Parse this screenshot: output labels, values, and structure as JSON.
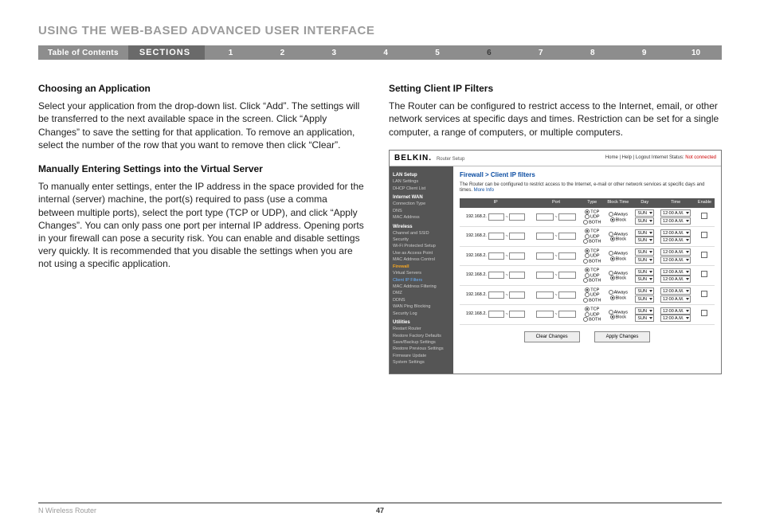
{
  "title": "USING THE WEB-BASED ADVANCED USER INTERFACE",
  "nav": {
    "toc": "Table of Contents",
    "sections": "SECTIONS",
    "items": [
      "1",
      "2",
      "3",
      "4",
      "5",
      "6",
      "7",
      "8",
      "9",
      "10"
    ],
    "active_index": 5
  },
  "left": {
    "h1": "Choosing an Application",
    "p1": "Select your application from the drop-down list. Click “Add”. The settings will be transferred to the next available space in the screen. Click “Apply Changes” to save the setting for that application. To remove an application, select the number of the row that you want to remove then click “Clear”.",
    "h2": "Manually Entering Settings into the Virtual Server",
    "p2": "To manually enter settings, enter the IP address in the space provided for the internal (server) machine, the port(s) required to pass (use a comma between multiple ports), select the port type (TCP or UDP), and click “Apply Changes”. You can only pass one port per internal IP address. Opening ports in your firewall can pose a security risk. You can enable and disable settings very quickly. It is recommended that you disable the settings when you are not using a specific application."
  },
  "right": {
    "h1": "Setting Client IP Filters",
    "p1": "The Router can be configured to restrict access to the Internet, email, or other network services at specific days and times. Restriction can be set for a single computer, a range of computers, or multiple computers."
  },
  "shot": {
    "brand": "BELKIN.",
    "brand_sub": "Router Setup",
    "toplinks_prefix": "Home | Help | Logout   Internet Status: ",
    "toplinks_status": "Not connected",
    "sidebar": [
      {
        "type": "hd",
        "t": "LAN Setup"
      },
      {
        "type": "it",
        "t": "LAN Settings"
      },
      {
        "type": "it",
        "t": "DHCP Client List"
      },
      {
        "type": "hd",
        "t": "Internet WAN"
      },
      {
        "type": "it",
        "t": "Connection Type"
      },
      {
        "type": "it",
        "t": "DNS"
      },
      {
        "type": "it",
        "t": "MAC Address"
      },
      {
        "type": "hd",
        "t": "Wireless"
      },
      {
        "type": "it",
        "t": "Channel and SSID"
      },
      {
        "type": "it",
        "t": "Security"
      },
      {
        "type": "it",
        "t": "Wi-Fi Protected Setup"
      },
      {
        "type": "it",
        "t": "Use as Access Point"
      },
      {
        "type": "it",
        "t": "MAC Address Control"
      },
      {
        "type": "fw",
        "t": "Firewall"
      },
      {
        "type": "it",
        "t": "Virtual Servers"
      },
      {
        "type": "cur",
        "t": "Client IP Filters"
      },
      {
        "type": "it",
        "t": "MAC Address Filtering"
      },
      {
        "type": "it",
        "t": "DMZ"
      },
      {
        "type": "it",
        "t": "DDNS"
      },
      {
        "type": "it",
        "t": "WAN Ping Blocking"
      },
      {
        "type": "it",
        "t": "Security Log"
      },
      {
        "type": "hd",
        "t": "Utilities"
      },
      {
        "type": "it",
        "t": "Restart Router"
      },
      {
        "type": "it",
        "t": "Restore Factory Defaults"
      },
      {
        "type": "it",
        "t": "Save/Backup Settings"
      },
      {
        "type": "it",
        "t": "Restore Previous Settings"
      },
      {
        "type": "it",
        "t": "Firmware Update"
      },
      {
        "type": "it",
        "t": "System Settings"
      }
    ],
    "breadcrumb": "Firewall > Client IP filters",
    "desc": "The Router can be configured to restrict access to the Internet, e-mail or other network services at specific days and times. ",
    "desc_link": "More Info",
    "headers": [
      "IP",
      "Port",
      "Type",
      "Block Time",
      "Day",
      "Time",
      "Enable"
    ],
    "ip_prefix": "192.168.2.",
    "types": [
      "TCP",
      "UDP",
      "BOTH"
    ],
    "block": [
      "Always",
      "Block"
    ],
    "day": "SUN",
    "time": "12:00 A.M.",
    "row_count": 6,
    "btn_clear": "Clear Changes",
    "btn_apply": "Apply Changes"
  },
  "footer": {
    "product": "N Wireless Router",
    "page": "47"
  }
}
